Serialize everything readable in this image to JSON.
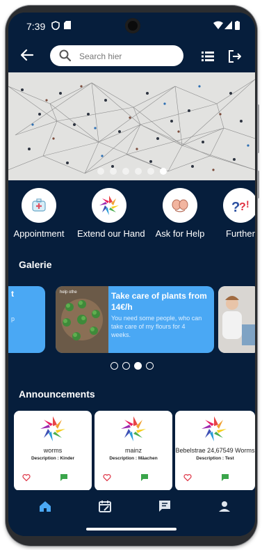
{
  "status_bar": {
    "time": "7:39"
  },
  "search": {
    "placeholder": "Search hier"
  },
  "quick_actions": [
    {
      "label": "Appointment",
      "icon": "medical-kit-icon"
    },
    {
      "label": "Extend our Hand",
      "icon": "community-hands-icon"
    },
    {
      "label": "Ask for Help",
      "icon": "helping-hands-icon"
    },
    {
      "label": "Further",
      "icon": "question-marks-icon"
    }
  ],
  "gallery": {
    "title": "Galerie",
    "cards": [
      {
        "title": "t",
        "desc": "p"
      },
      {
        "title": "Take care of plants from 14€/h",
        "desc": "You need some people, who can take care of my flours for 4 weeks."
      }
    ]
  },
  "announcements": {
    "title": "Announcements",
    "items": [
      {
        "name": "worms",
        "description": "Description : Kinder"
      },
      {
        "name": "mainz",
        "description": "Description : Mäachen"
      },
      {
        "name": "Bebelstrae 24,67549 Worms",
        "description": "Description : Test"
      }
    ]
  },
  "colors": {
    "background": "#061e3c",
    "accent": "#4aa8f4",
    "heart": "#e04050",
    "chat": "#3aa54a"
  }
}
